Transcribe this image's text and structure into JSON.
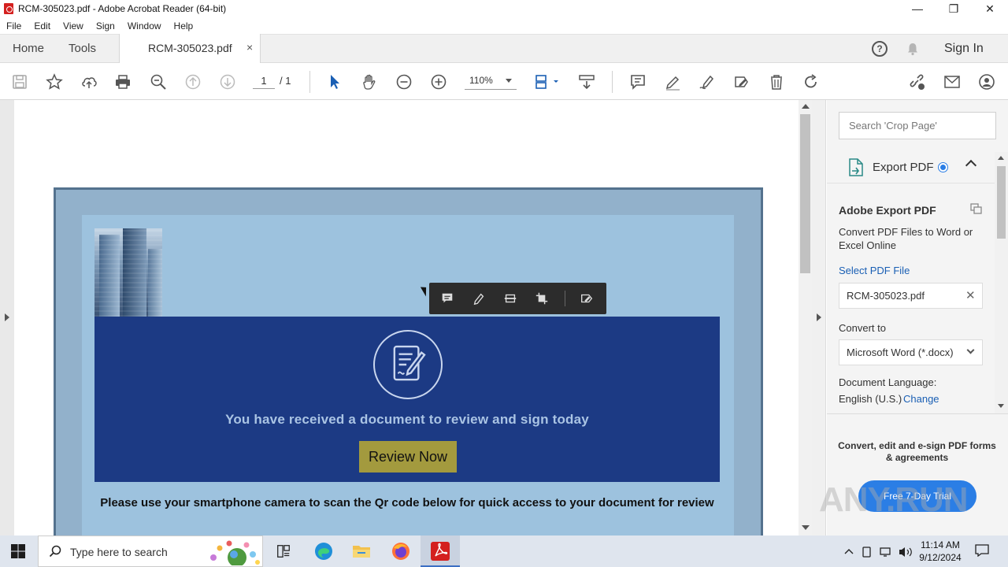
{
  "window": {
    "title": "RCM-305023.pdf - Adobe Acrobat Reader (64-bit)",
    "controls": [
      "—",
      "❐",
      "✕"
    ]
  },
  "menu": [
    "File",
    "Edit",
    "View",
    "Sign",
    "Window",
    "Help"
  ],
  "tabs": {
    "home": "Home",
    "tools": "Tools",
    "document": "RCM-305023.pdf",
    "close": "×",
    "sign_in": "Sign In",
    "help_symbol": "?"
  },
  "toolbar": {
    "page_current": "1",
    "page_total": "/ 1",
    "zoom": "110%",
    "icons": [
      "save-icon",
      "star-icon",
      "upload-icon",
      "print-icon",
      "zoom-out-search-icon",
      "page-up-icon",
      "page-down-icon",
      "select-cursor-icon",
      "hand-icon",
      "zoom-minus-icon",
      "zoom-plus-icon",
      "page-display-icon",
      "scroll-mode-icon",
      "comment-icon",
      "highlight-icon",
      "sign-icon",
      "fill-sign-icon",
      "delete-icon",
      "rotate-icon",
      "link-icon",
      "email-icon",
      "share-user-icon"
    ]
  },
  "document": {
    "headline": "You have received a document to review and sign today",
    "button": "Review Now",
    "qr_text": "Please use your smartphone camera to scan the Qr code below for quick access to your document for review",
    "colors": {
      "outer": "#92b1cb",
      "inner": "#9dc2de",
      "banner": "#1c3a84",
      "button": "#a39a3e"
    }
  },
  "quickbar": {
    "icons": [
      "comment-icon",
      "highlight-icon",
      "strikethrough-icon",
      "crop-icon",
      "sign-icon"
    ]
  },
  "right_pane": {
    "search_placeholder": "Search 'Crop Page'",
    "export_title": "Export PDF",
    "panel_heading": "Adobe Export PDF",
    "description": "Convert PDF Files to Word or Excel Online",
    "select_link": "Select PDF File",
    "file_name": "RCM-305023.pdf",
    "convert_to_label": "Convert to",
    "format": "Microsoft Word (*.docx)",
    "language_label": "Document Language:",
    "language_value": "English (U.S.)",
    "language_change": "Change",
    "promo": "Convert, edit and e-sign PDF forms & agreements",
    "trial_button": "Free 7-Day Trial"
  },
  "watermark": "ANY.RUN",
  "taskbar": {
    "search_placeholder": "Type here to search",
    "time": "11:14 AM",
    "date": "9/12/2024",
    "apps": [
      "task-view-icon",
      "edge-icon",
      "file-explorer-icon",
      "firefox-icon",
      "acrobat-icon"
    ]
  }
}
